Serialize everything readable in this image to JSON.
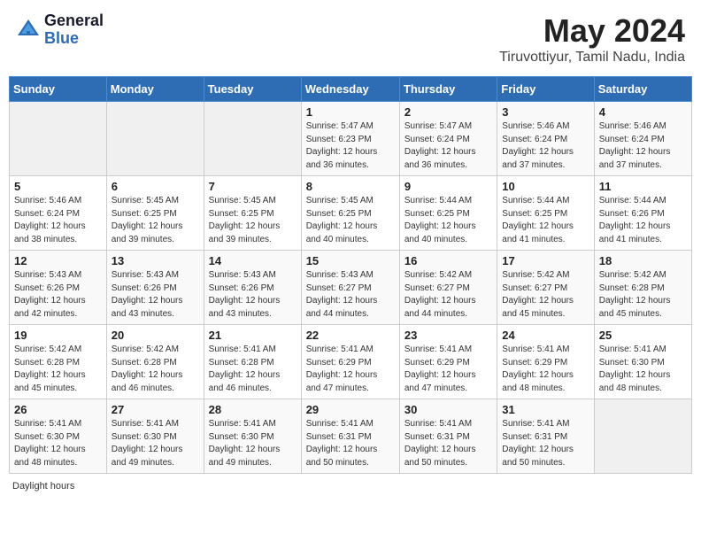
{
  "header": {
    "logo_general": "General",
    "logo_blue": "Blue",
    "month_title": "May 2024",
    "subtitle": "Tiruvottiyur, Tamil Nadu, India"
  },
  "calendar": {
    "days_of_week": [
      "Sunday",
      "Monday",
      "Tuesday",
      "Wednesday",
      "Thursday",
      "Friday",
      "Saturday"
    ],
    "weeks": [
      [
        {
          "day": "",
          "info": ""
        },
        {
          "day": "",
          "info": ""
        },
        {
          "day": "",
          "info": ""
        },
        {
          "day": "1",
          "info": "Sunrise: 5:47 AM\nSunset: 6:23 PM\nDaylight: 12 hours\nand 36 minutes."
        },
        {
          "day": "2",
          "info": "Sunrise: 5:47 AM\nSunset: 6:24 PM\nDaylight: 12 hours\nand 36 minutes."
        },
        {
          "day": "3",
          "info": "Sunrise: 5:46 AM\nSunset: 6:24 PM\nDaylight: 12 hours\nand 37 minutes."
        },
        {
          "day": "4",
          "info": "Sunrise: 5:46 AM\nSunset: 6:24 PM\nDaylight: 12 hours\nand 37 minutes."
        }
      ],
      [
        {
          "day": "5",
          "info": "Sunrise: 5:46 AM\nSunset: 6:24 PM\nDaylight: 12 hours\nand 38 minutes."
        },
        {
          "day": "6",
          "info": "Sunrise: 5:45 AM\nSunset: 6:25 PM\nDaylight: 12 hours\nand 39 minutes."
        },
        {
          "day": "7",
          "info": "Sunrise: 5:45 AM\nSunset: 6:25 PM\nDaylight: 12 hours\nand 39 minutes."
        },
        {
          "day": "8",
          "info": "Sunrise: 5:45 AM\nSunset: 6:25 PM\nDaylight: 12 hours\nand 40 minutes."
        },
        {
          "day": "9",
          "info": "Sunrise: 5:44 AM\nSunset: 6:25 PM\nDaylight: 12 hours\nand 40 minutes."
        },
        {
          "day": "10",
          "info": "Sunrise: 5:44 AM\nSunset: 6:25 PM\nDaylight: 12 hours\nand 41 minutes."
        },
        {
          "day": "11",
          "info": "Sunrise: 5:44 AM\nSunset: 6:26 PM\nDaylight: 12 hours\nand 41 minutes."
        }
      ],
      [
        {
          "day": "12",
          "info": "Sunrise: 5:43 AM\nSunset: 6:26 PM\nDaylight: 12 hours\nand 42 minutes."
        },
        {
          "day": "13",
          "info": "Sunrise: 5:43 AM\nSunset: 6:26 PM\nDaylight: 12 hours\nand 43 minutes."
        },
        {
          "day": "14",
          "info": "Sunrise: 5:43 AM\nSunset: 6:26 PM\nDaylight: 12 hours\nand 43 minutes."
        },
        {
          "day": "15",
          "info": "Sunrise: 5:43 AM\nSunset: 6:27 PM\nDaylight: 12 hours\nand 44 minutes."
        },
        {
          "day": "16",
          "info": "Sunrise: 5:42 AM\nSunset: 6:27 PM\nDaylight: 12 hours\nand 44 minutes."
        },
        {
          "day": "17",
          "info": "Sunrise: 5:42 AM\nSunset: 6:27 PM\nDaylight: 12 hours\nand 45 minutes."
        },
        {
          "day": "18",
          "info": "Sunrise: 5:42 AM\nSunset: 6:28 PM\nDaylight: 12 hours\nand 45 minutes."
        }
      ],
      [
        {
          "day": "19",
          "info": "Sunrise: 5:42 AM\nSunset: 6:28 PM\nDaylight: 12 hours\nand 45 minutes."
        },
        {
          "day": "20",
          "info": "Sunrise: 5:42 AM\nSunset: 6:28 PM\nDaylight: 12 hours\nand 46 minutes."
        },
        {
          "day": "21",
          "info": "Sunrise: 5:41 AM\nSunset: 6:28 PM\nDaylight: 12 hours\nand 46 minutes."
        },
        {
          "day": "22",
          "info": "Sunrise: 5:41 AM\nSunset: 6:29 PM\nDaylight: 12 hours\nand 47 minutes."
        },
        {
          "day": "23",
          "info": "Sunrise: 5:41 AM\nSunset: 6:29 PM\nDaylight: 12 hours\nand 47 minutes."
        },
        {
          "day": "24",
          "info": "Sunrise: 5:41 AM\nSunset: 6:29 PM\nDaylight: 12 hours\nand 48 minutes."
        },
        {
          "day": "25",
          "info": "Sunrise: 5:41 AM\nSunset: 6:30 PM\nDaylight: 12 hours\nand 48 minutes."
        }
      ],
      [
        {
          "day": "26",
          "info": "Sunrise: 5:41 AM\nSunset: 6:30 PM\nDaylight: 12 hours\nand 48 minutes."
        },
        {
          "day": "27",
          "info": "Sunrise: 5:41 AM\nSunset: 6:30 PM\nDaylight: 12 hours\nand 49 minutes."
        },
        {
          "day": "28",
          "info": "Sunrise: 5:41 AM\nSunset: 6:30 PM\nDaylight: 12 hours\nand 49 minutes."
        },
        {
          "day": "29",
          "info": "Sunrise: 5:41 AM\nSunset: 6:31 PM\nDaylight: 12 hours\nand 50 minutes."
        },
        {
          "day": "30",
          "info": "Sunrise: 5:41 AM\nSunset: 6:31 PM\nDaylight: 12 hours\nand 50 minutes."
        },
        {
          "day": "31",
          "info": "Sunrise: 5:41 AM\nSunset: 6:31 PM\nDaylight: 12 hours\nand 50 minutes."
        },
        {
          "day": "",
          "info": ""
        }
      ]
    ]
  },
  "footer": {
    "note": "Daylight hours"
  }
}
